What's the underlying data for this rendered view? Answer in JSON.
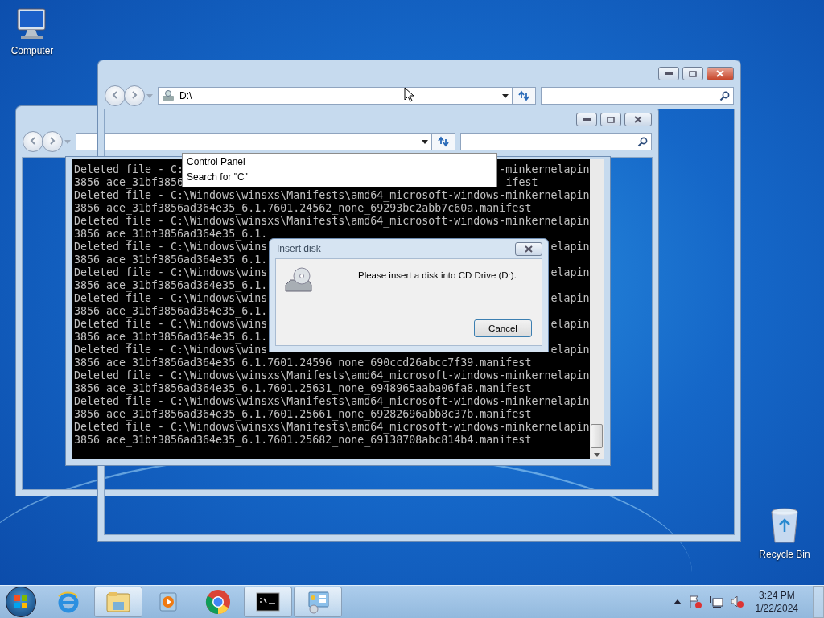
{
  "desktop_icons": [
    {
      "label": "Computer",
      "kind": "computer"
    },
    {
      "label": "Recycle Bin",
      "kind": "recycle-bin"
    }
  ],
  "explorer": {
    "address": "D:\\"
  },
  "console": {
    "lines": [
      "Deleted file - C:                                                 -minkernelapin",
      "3856 ace_31bf3856                                                  ifest",
      "Deleted file - C:\\Windows\\winsxs\\Manifests\\amd64_microsoft-windows-minkernelapin",
      "3856 ace_31bf3856ad364e35_6.1.7601.24562_none_69293bc2abb7c60a.manifest",
      "Deleted file - C:\\Windows\\winsxs\\Manifests\\amd64_microsoft-windows-minkernelapin",
      "3856 ace_31bf3856ad364e35_6.1.",
      "Deleted file - C:\\Windows\\wins                                            elapin",
      "3856 ace_31bf3856ad364e35_6.1.",
      "Deleted file - C:\\Windows\\wins                                            elapin",
      "3856 ace_31bf3856ad364e35_6.1.",
      "Deleted file - C:\\Windows\\wins                                            elapin",
      "3856 ace_31bf3856ad364e35_6.1.",
      "Deleted file - C:\\Windows\\wins                                            elapin",
      "3856 ace_31bf3856ad364e35_6.1.",
      "Deleted file - C:\\Windows\\wins                                            elapin",
      "3856 ace_31bf3856ad364e35_6.1.7601.24596_none_690ccd26abcc7f39.manifest",
      "Deleted file - C:\\Windows\\winsxs\\Manifests\\amd64_microsoft-windows-minkernelapin",
      "3856 ace_31bf3856ad364e35_6.1.7601.25631_none_6948965aaba06fa8.manifest",
      "Deleted file - C:\\Windows\\winsxs\\Manifests\\amd64_microsoft-windows-minkernelapin",
      "3856 ace_31bf3856ad364e35_6.1.7601.25661_none_69282696abb8c37b.manifest",
      "Deleted file - C:\\Windows\\winsxs\\Manifests\\amd64_microsoft-windows-minkernelapin",
      "3856 ace_31bf3856ad364e35_6.1.7601.25682_none_69138708abc814b4.manifest"
    ]
  },
  "autocomplete": {
    "items": [
      "Control Panel",
      "Search for \"C\""
    ]
  },
  "dialog": {
    "title": "Insert disk",
    "message": "Please insert a disk into CD Drive (D:).",
    "button": "Cancel"
  },
  "taskbar": {
    "items": [
      {
        "kind": "ie",
        "running": false
      },
      {
        "kind": "explorer",
        "running": true
      },
      {
        "kind": "media",
        "running": false
      },
      {
        "kind": "chrome",
        "running": false
      },
      {
        "kind": "cmd",
        "running": true
      },
      {
        "kind": "control-panel",
        "running": true
      }
    ]
  },
  "tray": {
    "time": "3:24 PM",
    "date": "1/22/2024"
  }
}
